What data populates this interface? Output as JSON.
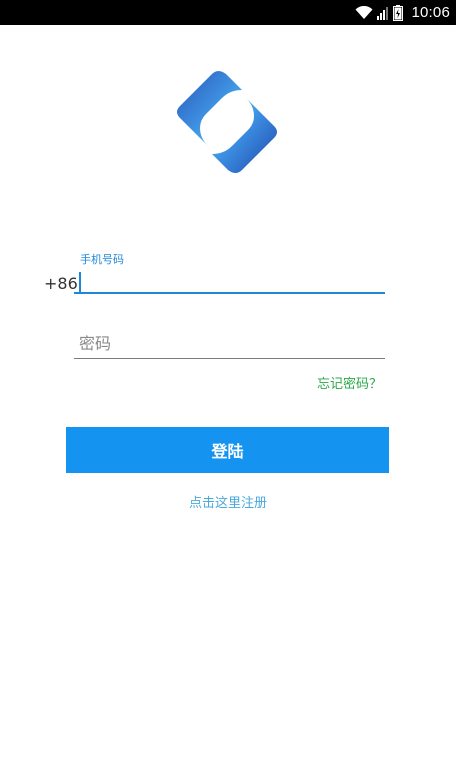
{
  "status_bar": {
    "time": "10:06",
    "icons": [
      "wifi-icon",
      "cell-signal-icon",
      "battery-icon"
    ]
  },
  "logo": {
    "icon": "app-logo",
    "colors": {
      "dark_blue": "#1f4fb0",
      "light_blue": "#58cff5"
    }
  },
  "phone": {
    "label": "手机号码",
    "country_code": "+86",
    "value": ""
  },
  "password": {
    "placeholder": "密码",
    "value": ""
  },
  "forgot_password": "忘记密码？",
  "login_button": "登陆",
  "register_link": "点击这里注册",
  "colors": {
    "accent": "#1e88d6",
    "button": "#1593f0",
    "link_green": "#2aa84a",
    "link_blue": "#4aa8dc"
  }
}
